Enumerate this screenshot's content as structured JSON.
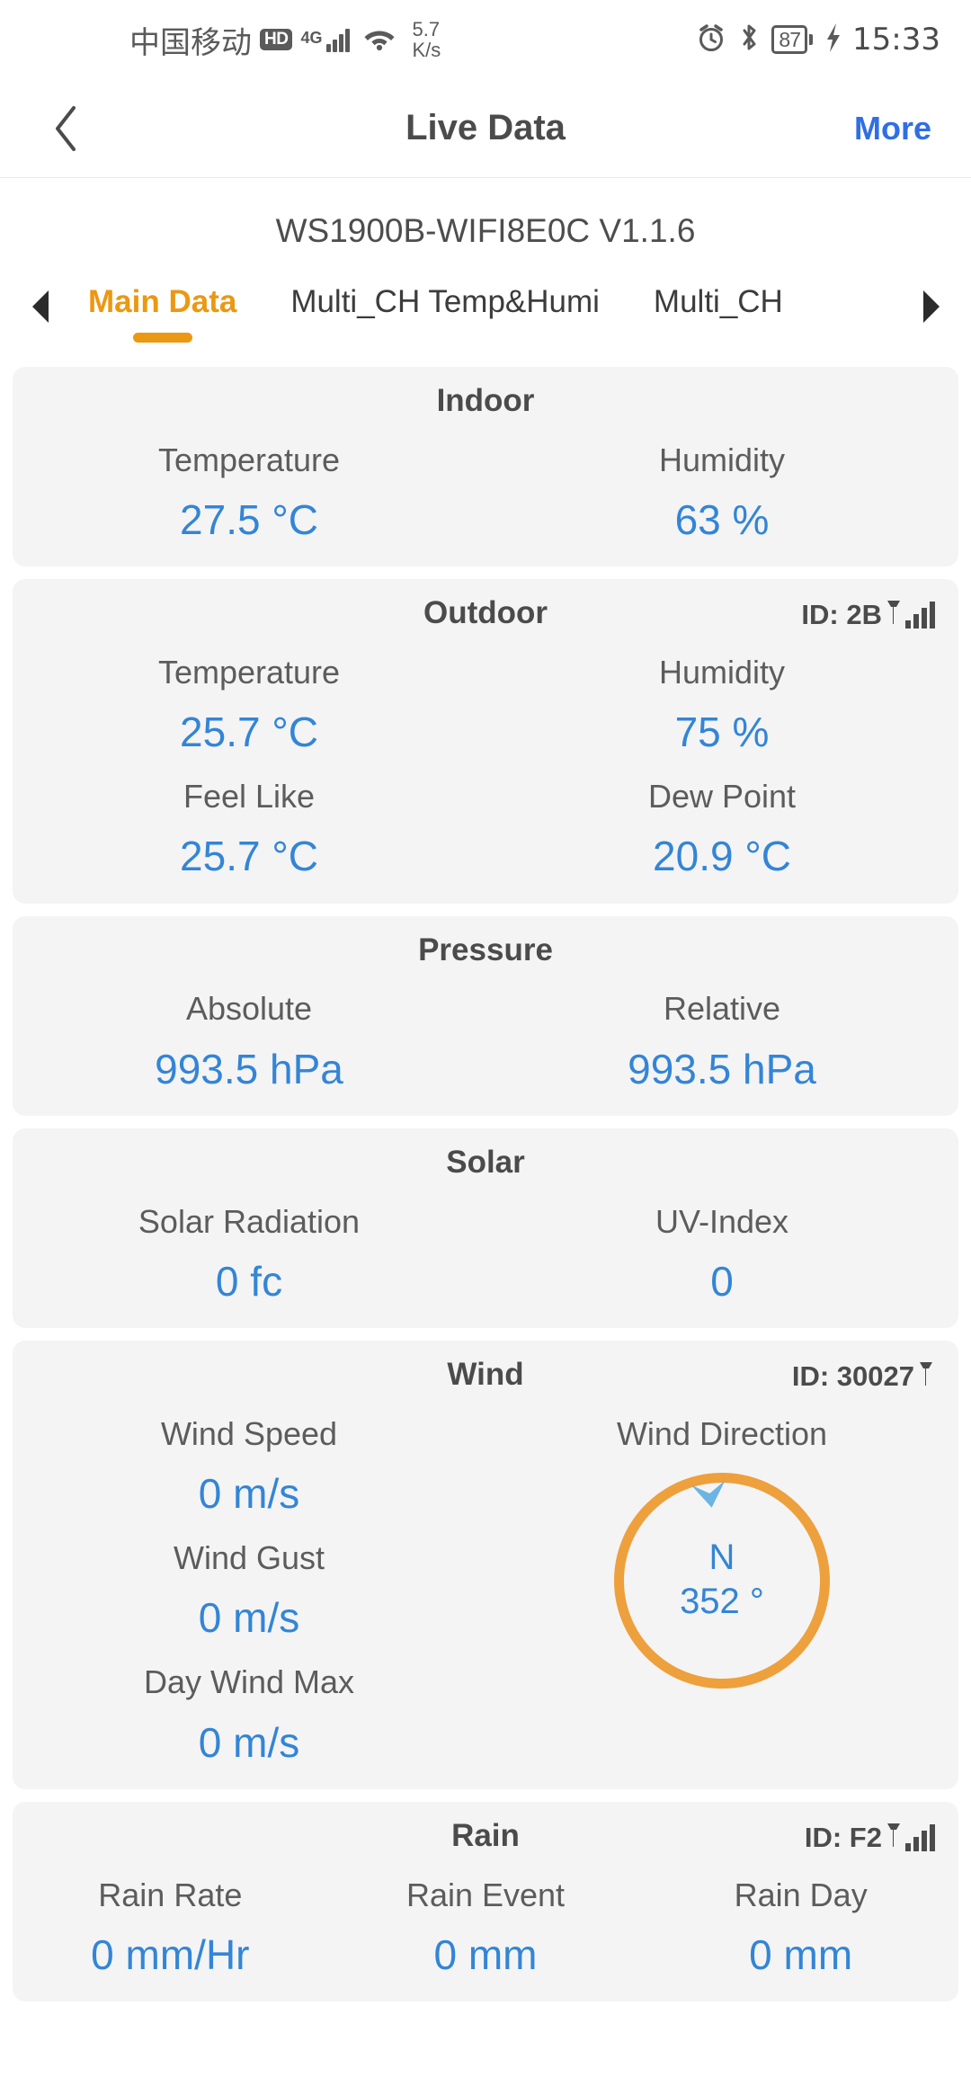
{
  "status_bar": {
    "carrier": "中国移动",
    "hd_badge": "HD",
    "network": "4G",
    "data_speed_value": "5.7",
    "data_speed_unit": "K/s",
    "battery_percent": "87",
    "time": "15:33"
  },
  "nav": {
    "title": "Live Data",
    "more_label": "More"
  },
  "device": {
    "name": "WS1900B-WIFI8E0C V1.1.6"
  },
  "tabs": [
    {
      "label": "Main Data",
      "active": true
    },
    {
      "label": "Multi_CH Temp&Humi",
      "active": false
    },
    {
      "label": "Multi_CH",
      "active": false
    }
  ],
  "cards": {
    "indoor": {
      "title": "Indoor",
      "metrics": [
        {
          "label": "Temperature",
          "value": "27.5 °C"
        },
        {
          "label": "Humidity",
          "value": "63 %"
        }
      ]
    },
    "outdoor": {
      "title": "Outdoor",
      "id": "ID: 2B",
      "metrics_row1": [
        {
          "label": "Temperature",
          "value": "25.7 °C"
        },
        {
          "label": "Humidity",
          "value": "75 %"
        }
      ],
      "metrics_row2": [
        {
          "label": "Feel Like",
          "value": "25.7 °C"
        },
        {
          "label": "Dew Point",
          "value": "20.9 °C"
        }
      ]
    },
    "pressure": {
      "title": "Pressure",
      "metrics": [
        {
          "label": "Absolute",
          "value": "993.5 hPa"
        },
        {
          "label": "Relative",
          "value": "993.5 hPa"
        }
      ]
    },
    "solar": {
      "title": "Solar",
      "metrics": [
        {
          "label": "Solar Radiation",
          "value": "0 fc"
        },
        {
          "label": "UV-Index",
          "value": "0"
        }
      ]
    },
    "wind": {
      "title": "Wind",
      "id": "ID: 30027",
      "metrics": [
        {
          "label": "Wind Speed",
          "value": "0 m/s"
        },
        {
          "label": "Wind Gust",
          "value": "0 m/s"
        },
        {
          "label": "Day Wind Max",
          "value": "0 m/s"
        }
      ],
      "direction_label": "Wind Direction",
      "direction_cardinal": "N",
      "direction_degrees": "352 °"
    },
    "rain": {
      "title": "Rain",
      "id": "ID: F2",
      "metrics": [
        {
          "label": "Rain Rate",
          "value": "0 mm/Hr"
        },
        {
          "label": "Rain Event",
          "value": "0 mm"
        },
        {
          "label": "Rain Day",
          "value": "0 mm"
        }
      ]
    }
  },
  "colors": {
    "accent_orange": "#eb9812",
    "value_blue": "#3385d6",
    "link_blue": "#2f6fe4",
    "compass_ring": "#eda03c",
    "compass_needle": "#6cb4e4",
    "card_bg": "#f4f4f4"
  }
}
